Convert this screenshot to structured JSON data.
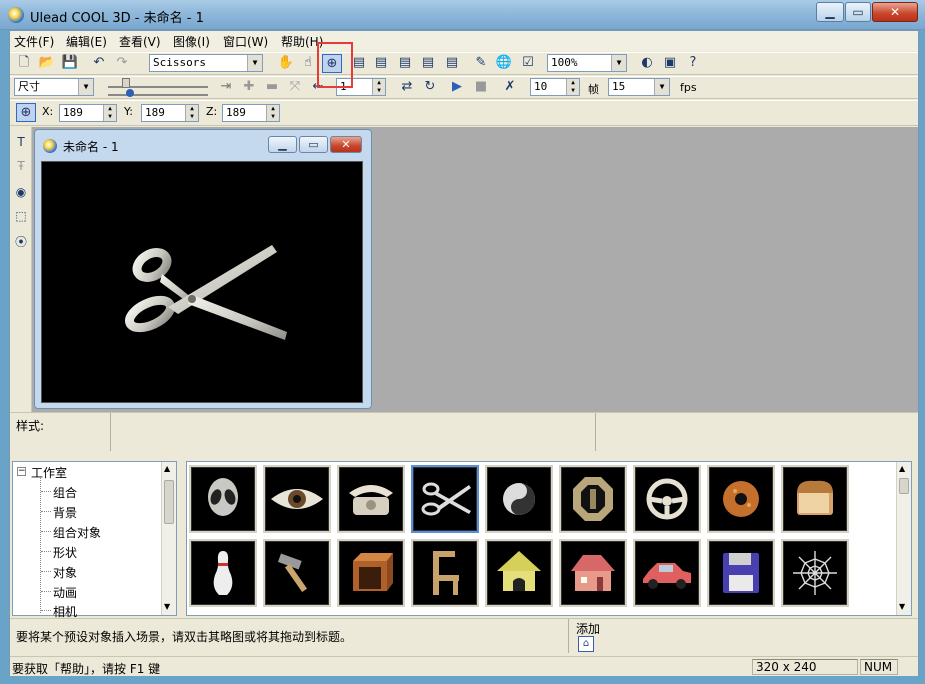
{
  "window": {
    "title": "Ulead COOL 3D - 未命名 - 1",
    "minimize_glyph": "▁",
    "maximize_glyph": "▭",
    "close_glyph": "✕"
  },
  "menu": [
    {
      "label": "文件(F)"
    },
    {
      "label": "编辑(E)"
    },
    {
      "label": "查看(V)"
    },
    {
      "label": "图像(I)"
    },
    {
      "label": "窗口(W)"
    },
    {
      "label": "帮助(H)"
    }
  ],
  "toolbar1": {
    "object_combo": "Scissors",
    "zoom_combo": "100%"
  },
  "toolbar2": {
    "size_combo": "尺寸",
    "frame_spin": "1",
    "frames_total": "10",
    "frame_unit": "帧",
    "fps_value": "15",
    "fps_label": "fps"
  },
  "toolbar3": {
    "x_label": "X:",
    "x_value": "189",
    "y_label": "Y:",
    "y_value": "189",
    "z_label": "Z:",
    "z_value": "189"
  },
  "document": {
    "title": "未命名 - 1"
  },
  "style_bar": {
    "label": "样式:"
  },
  "tree": {
    "root": "工作室",
    "items": [
      "组合",
      "背景",
      "组合对象",
      "形状",
      "对象",
      "动画",
      "相机"
    ]
  },
  "gallery": {
    "selected": "scissors",
    "items": [
      {
        "icon": "alien-icon"
      },
      {
        "icon": "eye-icon"
      },
      {
        "icon": "phone-icon"
      },
      {
        "icon": "scissors-icon"
      },
      {
        "icon": "yinyang-icon"
      },
      {
        "icon": "octagon-ring-icon"
      },
      {
        "icon": "steering-wheel-icon"
      },
      {
        "icon": "donut-icon"
      },
      {
        "icon": "bread-icon"
      },
      {
        "icon": "bowling-pin-icon"
      },
      {
        "icon": "hammer-icon"
      },
      {
        "icon": "cabinet-icon"
      },
      {
        "icon": "chair-icon"
      },
      {
        "icon": "doghouse-icon"
      },
      {
        "icon": "house-icon"
      },
      {
        "icon": "car-icon"
      },
      {
        "icon": "floppy-disk-icon"
      },
      {
        "icon": "spiderweb-icon"
      }
    ]
  },
  "hint": {
    "text": "要将某个预设对象插入场景，请双击其略图或将其拖动到标题。",
    "add_label": "添加"
  },
  "status": {
    "help": "要获取「帮助」，请按 F1 键",
    "resolution": "320 x 240",
    "num": "NUM"
  },
  "colors": {
    "highlight": "#e53b3b",
    "canvas_bg": "#000000",
    "workspace_bg": "#ababab"
  }
}
